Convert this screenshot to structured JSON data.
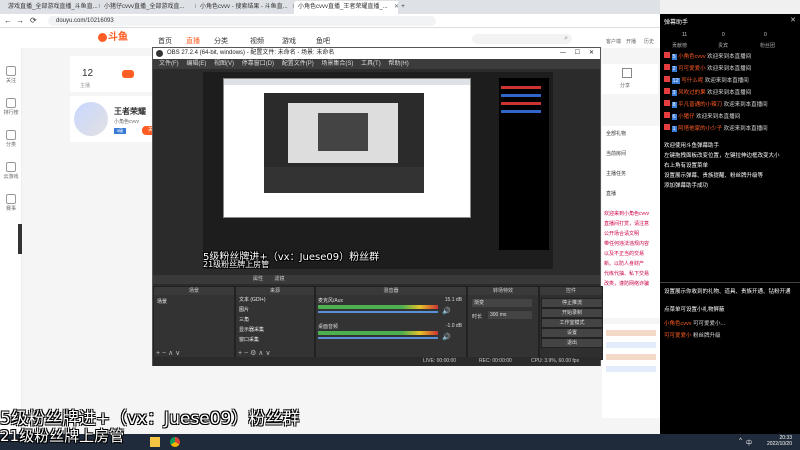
{
  "browser": {
    "tabs": [
      {
        "label": "游戏直播_全部游戏直播_斗鱼直...",
        "active": false
      },
      {
        "label": "小猪仔cvvv直播_全部游戏直...",
        "active": false
      },
      {
        "label": "小角色cvvv - 搜索结果 - 斗鱼直...",
        "active": false
      },
      {
        "label": "小角色cvvv直播_王者荣耀直播_...",
        "active": true
      }
    ],
    "url": "douyu.com/10216093",
    "nav": {
      "back": "←",
      "forward": "→",
      "reload": "⟳",
      "new_tab": "+"
    },
    "window_controls": {
      "minimize": "—",
      "maximize": "☐",
      "close": "✕"
    }
  },
  "site": {
    "logo": "斗鱼",
    "nav_items": [
      "首页",
      "直播",
      "分类",
      "视频",
      "游戏",
      "鱼吧"
    ],
    "right_items": [
      "客户端",
      "开播",
      "历史",
      "关注"
    ],
    "left_rail": [
      "关注",
      "排行榜",
      "分类",
      "云游戏",
      "赛事"
    ],
    "follow_count": "12",
    "follow_label": "主播",
    "streamer_title": "王者荣耀",
    "streamer_name": "小角色cvvv",
    "streamer_badge": "5级",
    "right_text": [
      "举报",
      "分享",
      "关注"
    ],
    "chat_preview": [
      "欢迎来到小角色cvvv",
      "直播间打赏，请注意",
      "公开场合请文明",
      "带任何违法违规内容",
      "以及不正当的交易",
      "新。以防人身财产",
      "代练代抽、私下交易",
      "改类，谨防网络诈骗"
    ],
    "ad_items": [
      "全部礼物",
      "当前房间",
      "主播任务"
    ],
    "live_tags": [
      "直播",
      "免费领取"
    ]
  },
  "obs": {
    "title": "OBS 27.2.4 (64-bit, windows) - 配置文件: 未命名 - 场景: 未命名",
    "menu": [
      "文件(F)",
      "编辑(E)",
      "视图(V)",
      "停靠窗口(D)",
      "配置文件(P)",
      "场景集合(S)",
      "工具(T)",
      "帮助(H)"
    ],
    "source_toolbar": [
      "属性",
      "滤镜"
    ],
    "docks": {
      "scenes_title": "场景",
      "scenes": [
        "场景"
      ],
      "sources_title": "来源",
      "sources": [
        "文本 (GDI+)",
        "图片",
        "三角",
        "显示器采集",
        "窗口采集"
      ],
      "mixer_title": "混音器",
      "mixer": [
        {
          "name": "麦克风/Aux",
          "level": "15.1 dB"
        },
        {
          "name": "桌面音频",
          "level": "-1.0 dB"
        }
      ],
      "transitions_title": "转场特效",
      "transition_value": "渐变",
      "duration_label": "时长",
      "duration_value": "300 ms",
      "controls_title": "控件",
      "controls": [
        "停止推流",
        "开始录制",
        "工作室模式",
        "设置",
        "退出"
      ]
    },
    "status": {
      "live": "LIVE: 00:00:00",
      "rec": "REC: 00:00:00",
      "cpu": "CPU: 3.9%, 60.00 fps"
    },
    "preview_overlay_line1": "5级粉丝牌进+（vx：Juese09）粉丝群",
    "preview_overlay_line2": "21级粉丝牌上房管"
  },
  "chat_panel": {
    "title": "弹幕助手",
    "close": "✕",
    "tabs": [
      "弹幕",
      "礼物",
      "贵宾"
    ],
    "stats": [
      "11",
      "0",
      "0"
    ],
    "headers": [
      "贡献榜",
      "贵宾",
      "粉丝团"
    ],
    "messages": [
      {
        "badge": "5",
        "user": "小角色cvvv",
        "text": "欢迎来到本直播间"
      },
      {
        "badge": "2",
        "user": "可可爱爱小",
        "text": "欢迎来到本直播间"
      },
      {
        "badge": "12",
        "user": "写什么呢",
        "text": "欢迎来到本直播间"
      },
      {
        "badge": "3",
        "user": "风吹过的果",
        "text": "欢迎来到本直播间"
      },
      {
        "badge": "8",
        "user": "平凡普通的小辣刀",
        "text": "欢迎来到本直播间"
      },
      {
        "badge": "6",
        "user": "小猪仔",
        "text": "欢迎来到本直播间"
      },
      {
        "badge": "1",
        "user": "阿塔他家的小少子",
        "text": "欢迎来到本直播间"
      }
    ],
    "help_lines": [
      "欢迎使用斗鱼弹幕助手",
      "左键拖拽面板改变位置，左键拉伸边框改变大小",
      "右上角有设置菜单",
      "设置展示弹幕、贵族提醒、粉丝牌升级等",
      "添加弹幕助手成功"
    ],
    "footer_lines": [
      "设置展示你收到的礼物、道具、贵族开通、钻粉开通",
      "点菜单可设置小礼物屏蔽"
    ],
    "footer_msgs": [
      {
        "user": "小角色cvvv",
        "text": "可可爱爱小..."
      },
      {
        "user": "可可爱爱小",
        "text": "粉丝牌升级"
      }
    ]
  },
  "taskbar": {
    "time": "20:33",
    "date": "2022/10/20",
    "tray": [
      "^",
      "中",
      "英"
    ]
  },
  "overlay": {
    "line1": "5级粉丝牌进+（vx：Juese09）粉丝群",
    "line2": "21级粉丝牌上房管"
  },
  "colors": {
    "douyu_orange": "#ff5d23",
    "obs_dark": "#2b2b2b",
    "chat_bg": "#000000",
    "badge_red": "#e43d3d",
    "badge_blue": "#3a7bd5"
  }
}
